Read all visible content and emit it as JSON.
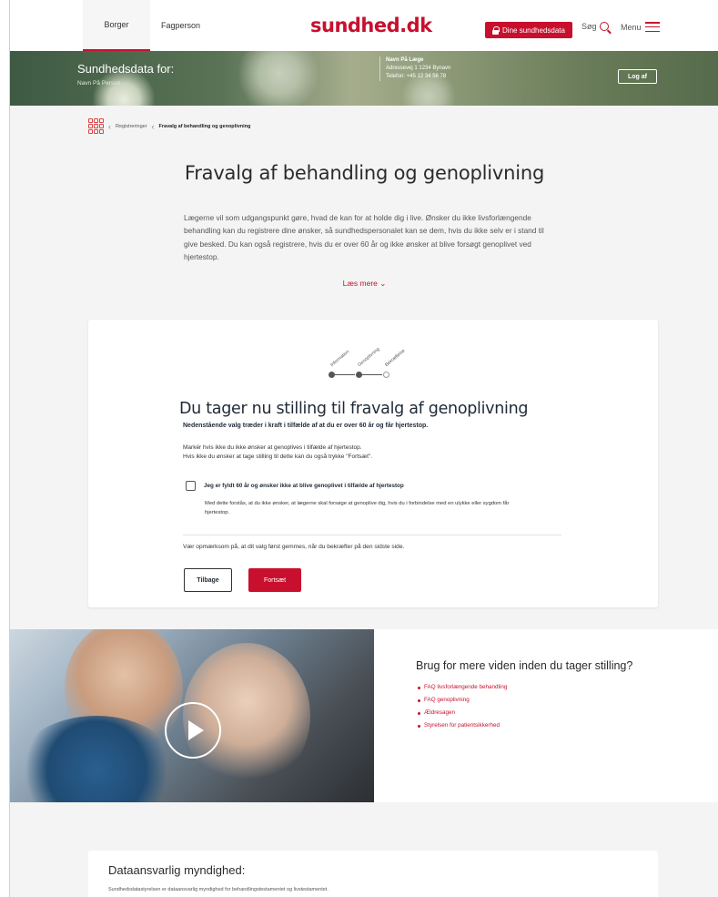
{
  "nav": {
    "tab_borger": "Borger",
    "tab_fagperson": "Fagperson",
    "brand": "sundhed.dk",
    "data_button": "Dine sundhedsdata",
    "search_label": "Søg",
    "menu_label": "Menu",
    "accent": "#c8102e"
  },
  "banner": {
    "title": "Sundhedsdata for:",
    "person_name": "Navn På Person",
    "doctor_name": "Navn På Læge",
    "doctor_address": "Adressevej 1 1234 Bynavn",
    "doctor_phone": "Telefon: +45 12 34 56 78",
    "logout_label": "Log af"
  },
  "breadcrumb": {
    "items": [
      "Registreringer",
      "Fravalg af behandling og genoplivning"
    ]
  },
  "page": {
    "title": "Fravalg af behandling og genoplivning",
    "intro": "Lægerne vil som udgangspunkt gøre, hvad de kan for at holde dig i live. Ønsker du ikke livsforlængende behandling kan du registrere dine ønsker, så sundhedspersonalet kan se dem, hvis du ikke selv er i stand til give besked. Du kan også registrere, hvis du er over 60 år og ikke ønsker at blive forsøgt genoplivet ved hjertestop.",
    "read_more": "Læs mere"
  },
  "stepper": {
    "steps": [
      "Information",
      "Genoplivning",
      "Bekræftelse"
    ],
    "current_step": 2
  },
  "form": {
    "heading": "Du tager nu stilling til fravalg af genoplivning",
    "subheading": "Nedenstående valg træder i kraft i tilfælde af at du er over 60 år og får hjertestop.",
    "instruction_1": "Markér hvis ikke du ikke ønsker at genoplives i tilfælde af hjertestop.",
    "instruction_2": "Hvis ikke du ønsker at tage stilling til dette kan du også trykke \"Fortsæt\".",
    "checkbox_label": "Jeg er fyldt 60 år og ønsker ikke at blive genoplivet i tilfælde af hjertestop",
    "checkbox_checked": false,
    "checkbox_description": "Med dette forstås, at du ikke ønsker, at lægerne skal forsøge at genoplive dig, hvis du i forbindelse med en ulykke eller sygdom får hjertestop.",
    "note": "Vær opmærksom på, at dit valg først gemmes, når du bekræfter på den sidste side.",
    "back_label": "Tilbage",
    "next_label": "Fortsæt"
  },
  "info": {
    "title": "Brug for mere viden inden du tager stilling?",
    "links": [
      "FAQ livsforlængende behandling",
      "FAQ genoplivning",
      "Ældresagen",
      "Styrelsen for patientsikkerhed"
    ]
  },
  "footer": {
    "title": "Dataansvarlig myndighed:",
    "text": "Sundhedsdatastyrelsen er dataansvarlig myndighed for behandlingstestamentet og livstestamentet."
  }
}
